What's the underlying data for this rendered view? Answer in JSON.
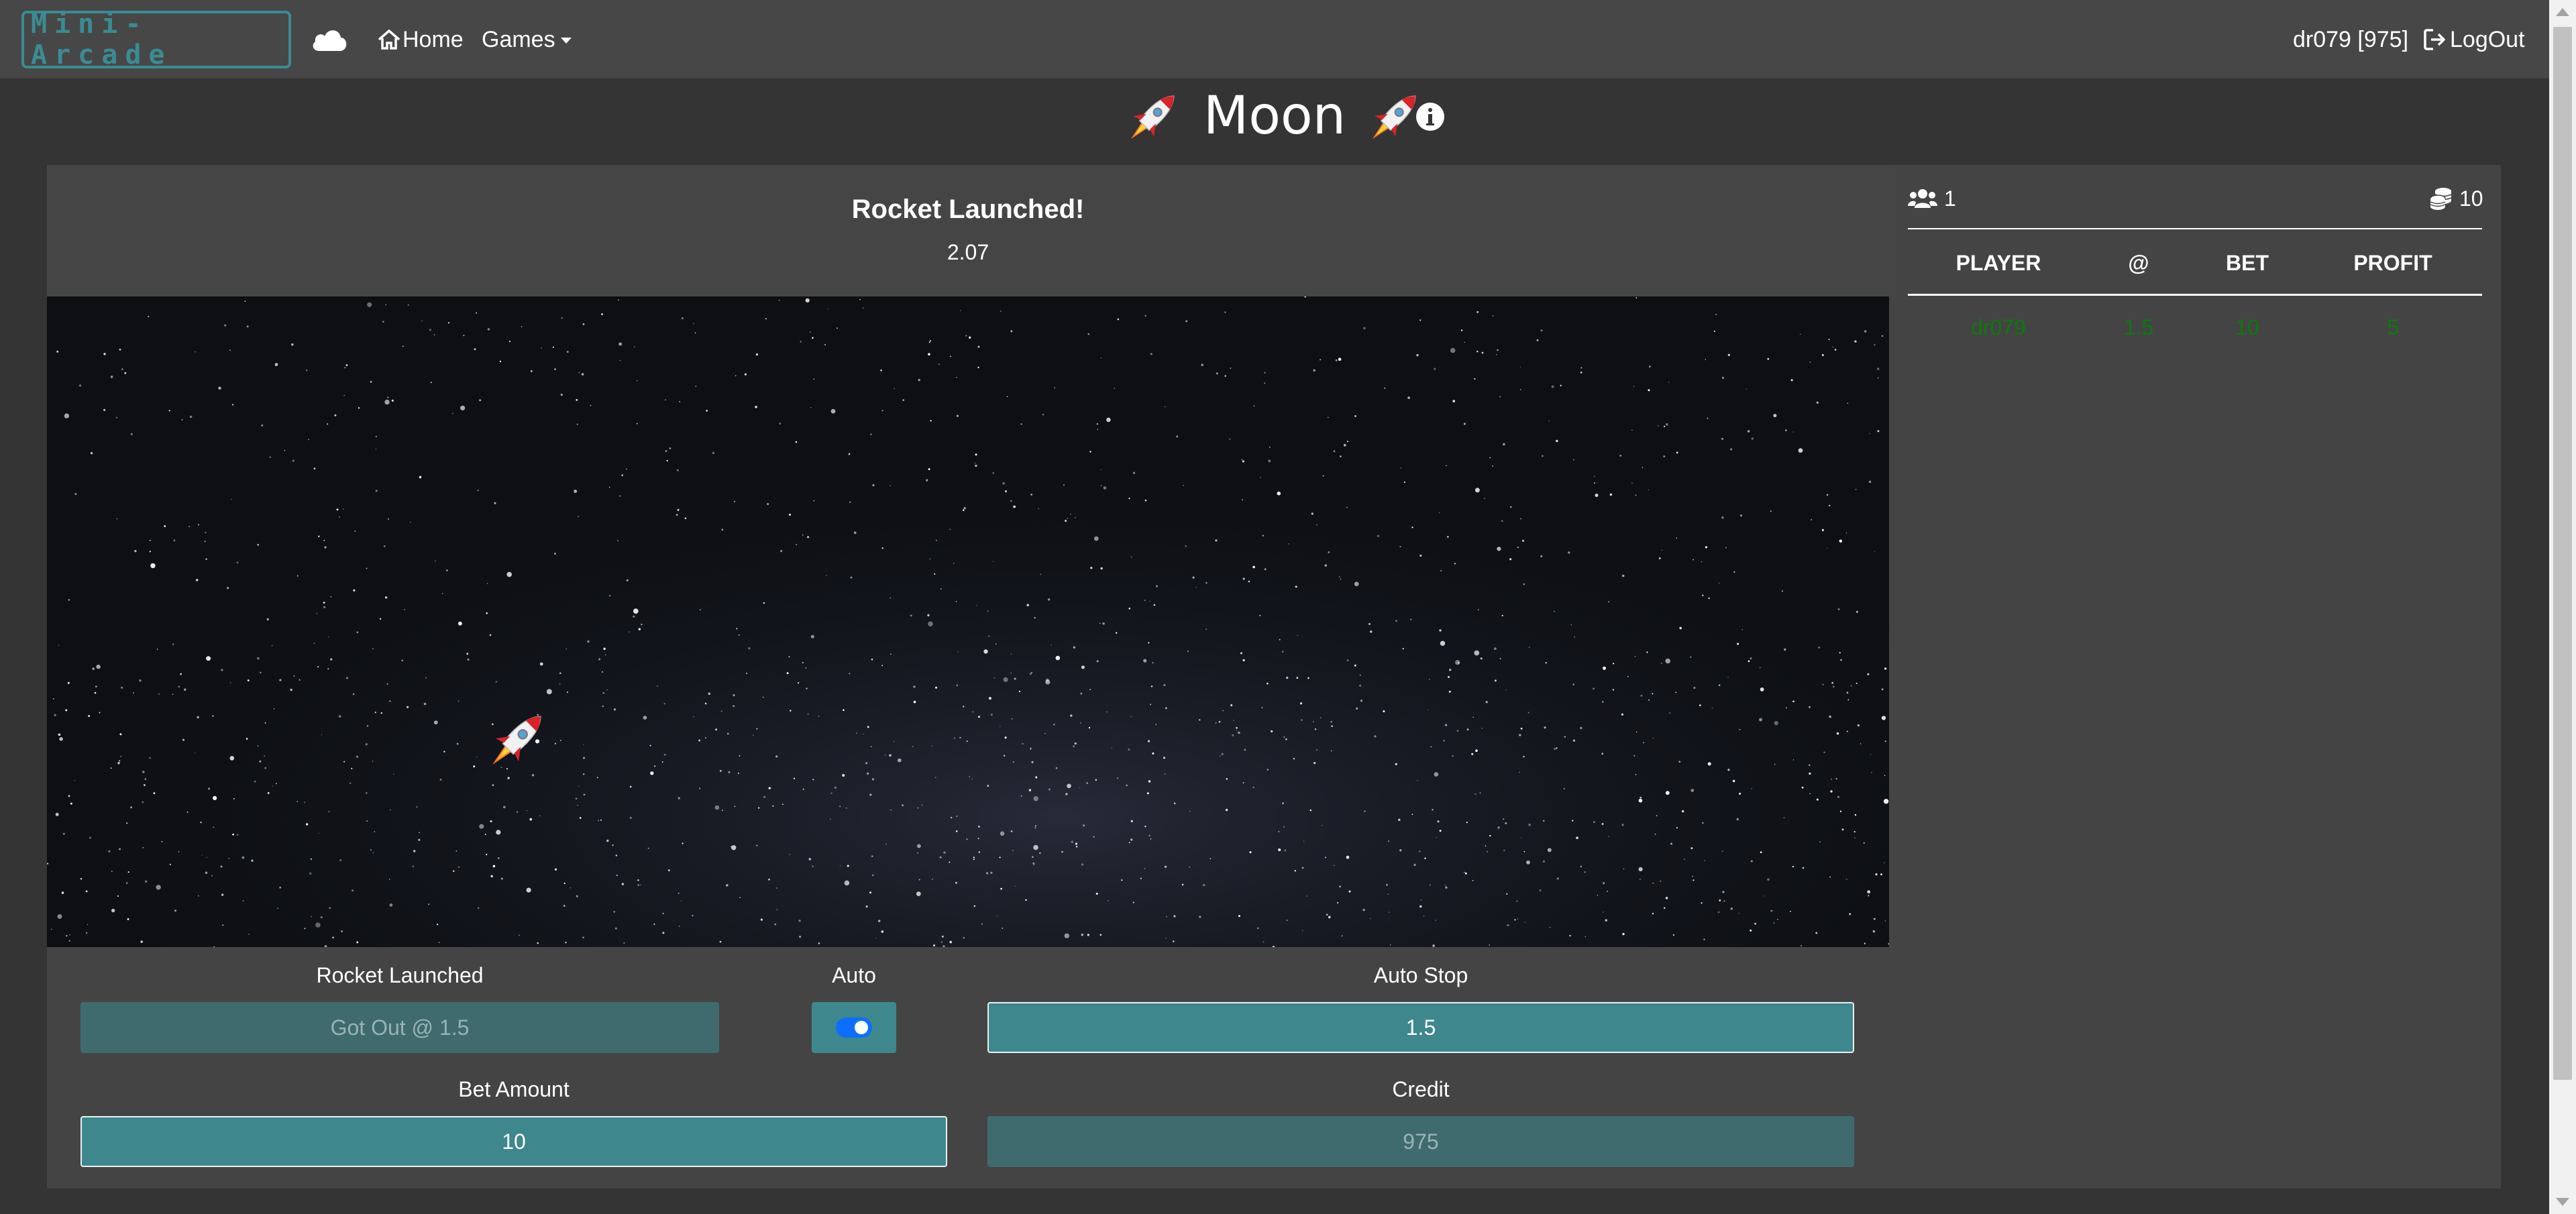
{
  "navbar": {
    "brand": "Mini-Arcade",
    "home_label": "Home",
    "games_label": "Games",
    "user_label": "dr079 [975]",
    "logout_label": "LogOut"
  },
  "page": {
    "title": "Moon"
  },
  "game": {
    "status_text": "Rocket Launched!",
    "multiplier": "2.07"
  },
  "controls": {
    "rocket_launched_label": "Rocket Launched",
    "rocket_launched_value": "Got Out @ 1.5",
    "auto_label": "Auto",
    "auto_enabled": true,
    "auto_stop_label": "Auto Stop",
    "auto_stop_value": "1.5",
    "bet_amount_label": "Bet Amount",
    "bet_amount_value": "10",
    "credit_label": "Credit",
    "credit_value": "975"
  },
  "side": {
    "players_count": "1",
    "total_bet": "10",
    "columns": [
      "PLAYER",
      "@",
      "BET",
      "PROFIT"
    ],
    "rows": [
      {
        "player": "dr079",
        "at": "1.5",
        "bet": "10",
        "profit": "5"
      }
    ]
  },
  "colors": {
    "accent": "#3e878d",
    "profit": "#0b7a0b",
    "toggle": "#0d6efd"
  }
}
